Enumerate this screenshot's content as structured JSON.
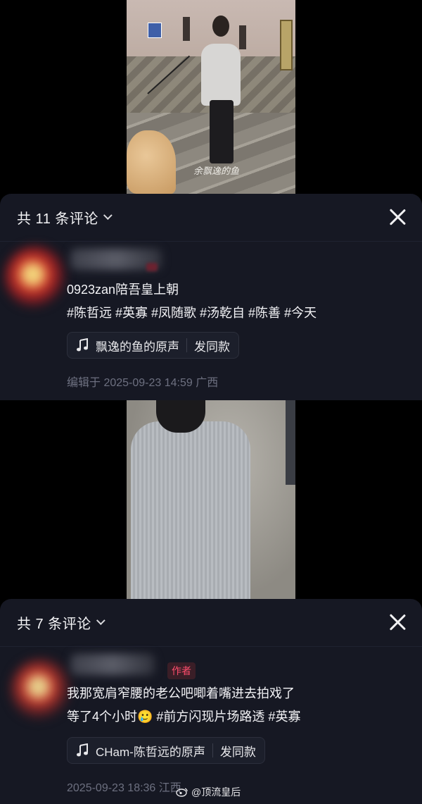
{
  "videos": {
    "top": {
      "watermark_text": "余飘逸的鱼"
    },
    "bottom": {}
  },
  "panels": [
    {
      "header": {
        "title": "共 11 条评论"
      },
      "comment": {
        "lines": [
          "0923zan陪吾皇上朝",
          "#陈哲远 #英寡 #凤随歌 #汤乾自 #陈善 #今天"
        ],
        "music_label": "飘逸的鱼的原声",
        "music_action": "发同款",
        "meta": "编辑于  2025-09-23 14:59  广西"
      }
    },
    {
      "header": {
        "title": "共 7 条评论"
      },
      "comment": {
        "author_badge": "作者",
        "lines": [
          "我那宽肩窄腰的老公吧唧着嘴进去拍戏了",
          "等了4个小时🥲 #前方闪现片场路透 #英寡"
        ],
        "music_label": "CHam-陈哲远的原声",
        "music_action": "发同款",
        "meta": "2025-09-23 18:36  江西"
      }
    }
  ],
  "watermark": {
    "text": "@顶流皇后"
  },
  "colors": {
    "panel_bg": "#161823",
    "meta_gray": "#6d7080",
    "author_red": "#ff4d6d"
  }
}
